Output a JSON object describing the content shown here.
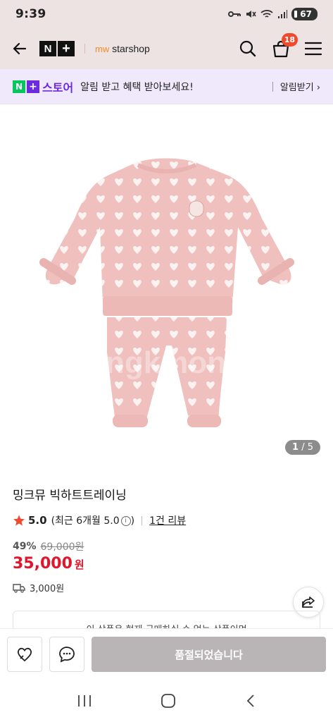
{
  "status_bar": {
    "time": "9:39",
    "battery": "67"
  },
  "header": {
    "logo_left": "N",
    "logo_right": "+",
    "store_prefix": "mw",
    "store_name": "starshop",
    "cart_count": "18"
  },
  "promo": {
    "logo_n": "N",
    "logo_plus": "+",
    "logo_text": "스토어",
    "message": "알림 받고 혜택 받아보세요!",
    "link_label": "알림받기 ›"
  },
  "gallery": {
    "current": "1",
    "separator": " / ",
    "total": "5",
    "watermark": "ngkmon"
  },
  "product": {
    "title": "밍크뮤 빅하트트레이닝",
    "rating": "5.0",
    "rating_detail_prefix": "(최근 6개월 5.0",
    "rating_detail_suffix": ")",
    "info_glyph": "i",
    "review_link": "1건 리뷰",
    "discount_rate": "49%",
    "original_price": "69,000원",
    "price": "35,000",
    "price_unit": "원",
    "shipping_fee": "3,000원"
  },
  "notice": {
    "text": "이 상품은 현재 구매하실 수 없는 상품이며"
  },
  "bottom_bar": {
    "soldout_label": "품절되었습니다"
  },
  "colors": {
    "accent_red": "#e0162c",
    "header_bg": "#ede3e3",
    "promo_bg": "#efe9fb",
    "naver_green": "#03c75a",
    "naver_purple": "#6d2be0",
    "soldout_gray": "#b9b5b6"
  }
}
